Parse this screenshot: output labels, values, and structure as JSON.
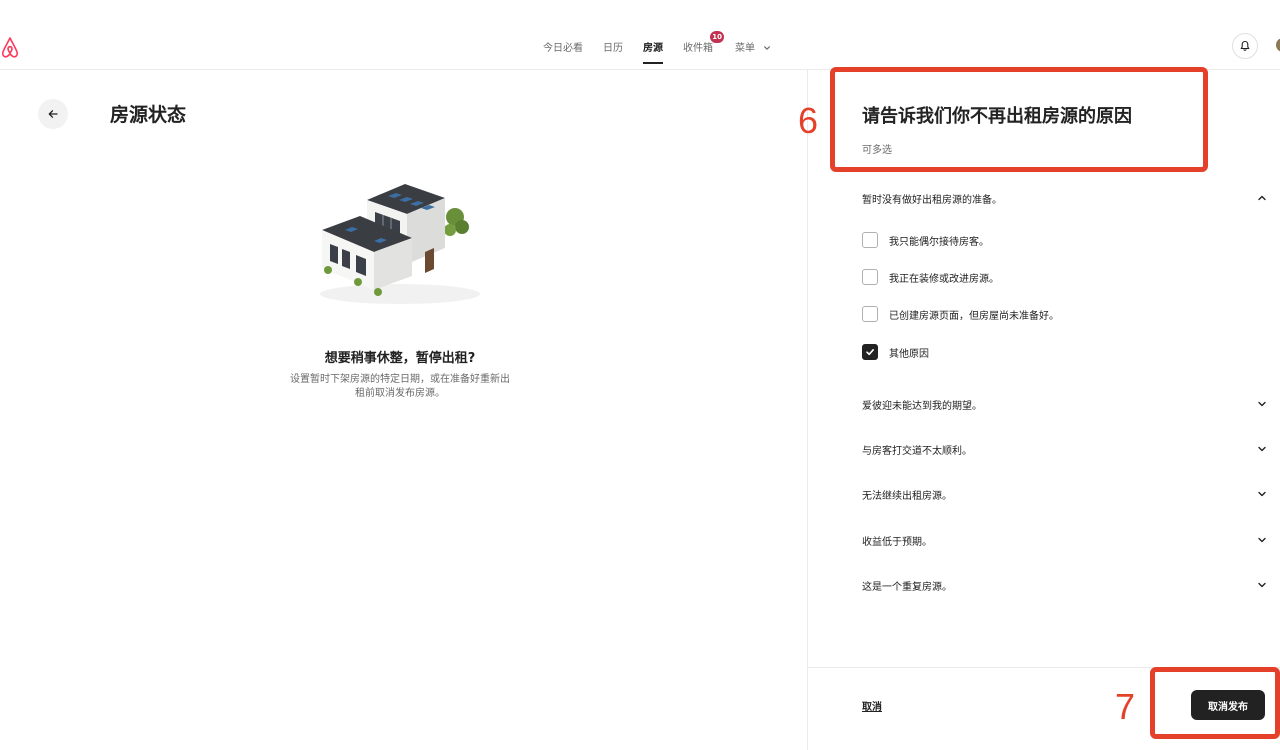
{
  "nav": {
    "items": [
      {
        "label": "今日必看",
        "active": false
      },
      {
        "label": "日历",
        "active": false
      },
      {
        "label": "房源",
        "active": true
      },
      {
        "label": "收件箱",
        "active": false,
        "badge": "10"
      }
    ],
    "menu_label": "菜单",
    "logo_icon": "airbnb-logo-icon",
    "brand_color": "#ff385c",
    "badge_color": "#c13253"
  },
  "left": {
    "title": "房源状态",
    "pause_title": "想要稍事休整，暂停出租?",
    "pause_desc": "设置暂时下架房源的特定日期，或在准备好重新出租前取消发布房源。"
  },
  "panel": {
    "title": "请告诉我们你不再出租房源的原因",
    "subtitle": "可多选",
    "sections": [
      {
        "label": "暂时没有做好出租房源的准备。",
        "expanded": true,
        "options": [
          {
            "label": "我只能偶尔接待房客。",
            "checked": false
          },
          {
            "label": "我正在装修或改进房源。",
            "checked": false
          },
          {
            "label": "已创建房源页面，但房屋尚未准备好。",
            "checked": false
          },
          {
            "label": "其他原因",
            "checked": true
          }
        ]
      },
      {
        "label": "爱彼迎未能达到我的期望。",
        "expanded": false
      },
      {
        "label": "与房客打交道不太顺利。",
        "expanded": false
      },
      {
        "label": "无法继续出租房源。",
        "expanded": false
      },
      {
        "label": "收益低于预期。",
        "expanded": false
      },
      {
        "label": "这是一个重复房源。",
        "expanded": false
      }
    ],
    "cancel_label": "取消",
    "unpublish_label": "取消发布"
  },
  "annotations": {
    "step_a": "6",
    "step_b": "7",
    "color": "#e5402a"
  }
}
